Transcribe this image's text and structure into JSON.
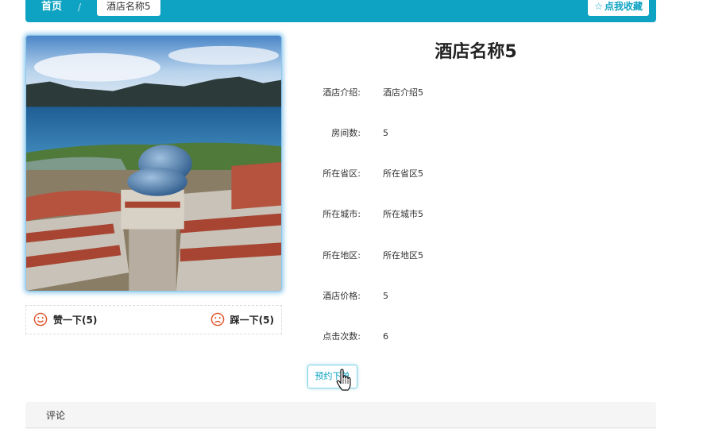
{
  "breadcrumb": {
    "home": "首页",
    "separator": "/",
    "current": "酒店名称5"
  },
  "favorite_button": {
    "icon": "star-outline-icon",
    "label": "点我收藏"
  },
  "hotel": {
    "title": "酒店名称5",
    "image": "hotel-photo",
    "details": [
      {
        "label": "酒店介绍:",
        "value": "酒店介绍5"
      },
      {
        "label": "房间数:",
        "value": "5"
      },
      {
        "label": "所在省区:",
        "value": "所在省区5"
      },
      {
        "label": "所在城市:",
        "value": "所在城市5"
      },
      {
        "label": "所在地区:",
        "value": "所在地区5"
      },
      {
        "label": "酒店价格:",
        "value": "5"
      },
      {
        "label": "点击次数:",
        "value": "6"
      }
    ]
  },
  "votes": {
    "like_icon": "smile-icon",
    "like_label": "赞一下(5)",
    "dislike_icon": "frown-icon",
    "dislike_label": "踩一下(5)"
  },
  "book_button": {
    "label": "预约下单"
  },
  "comments": {
    "title": "评论"
  },
  "colors": {
    "accent": "#0ea3c2",
    "vote_icon": "#e0542c"
  }
}
